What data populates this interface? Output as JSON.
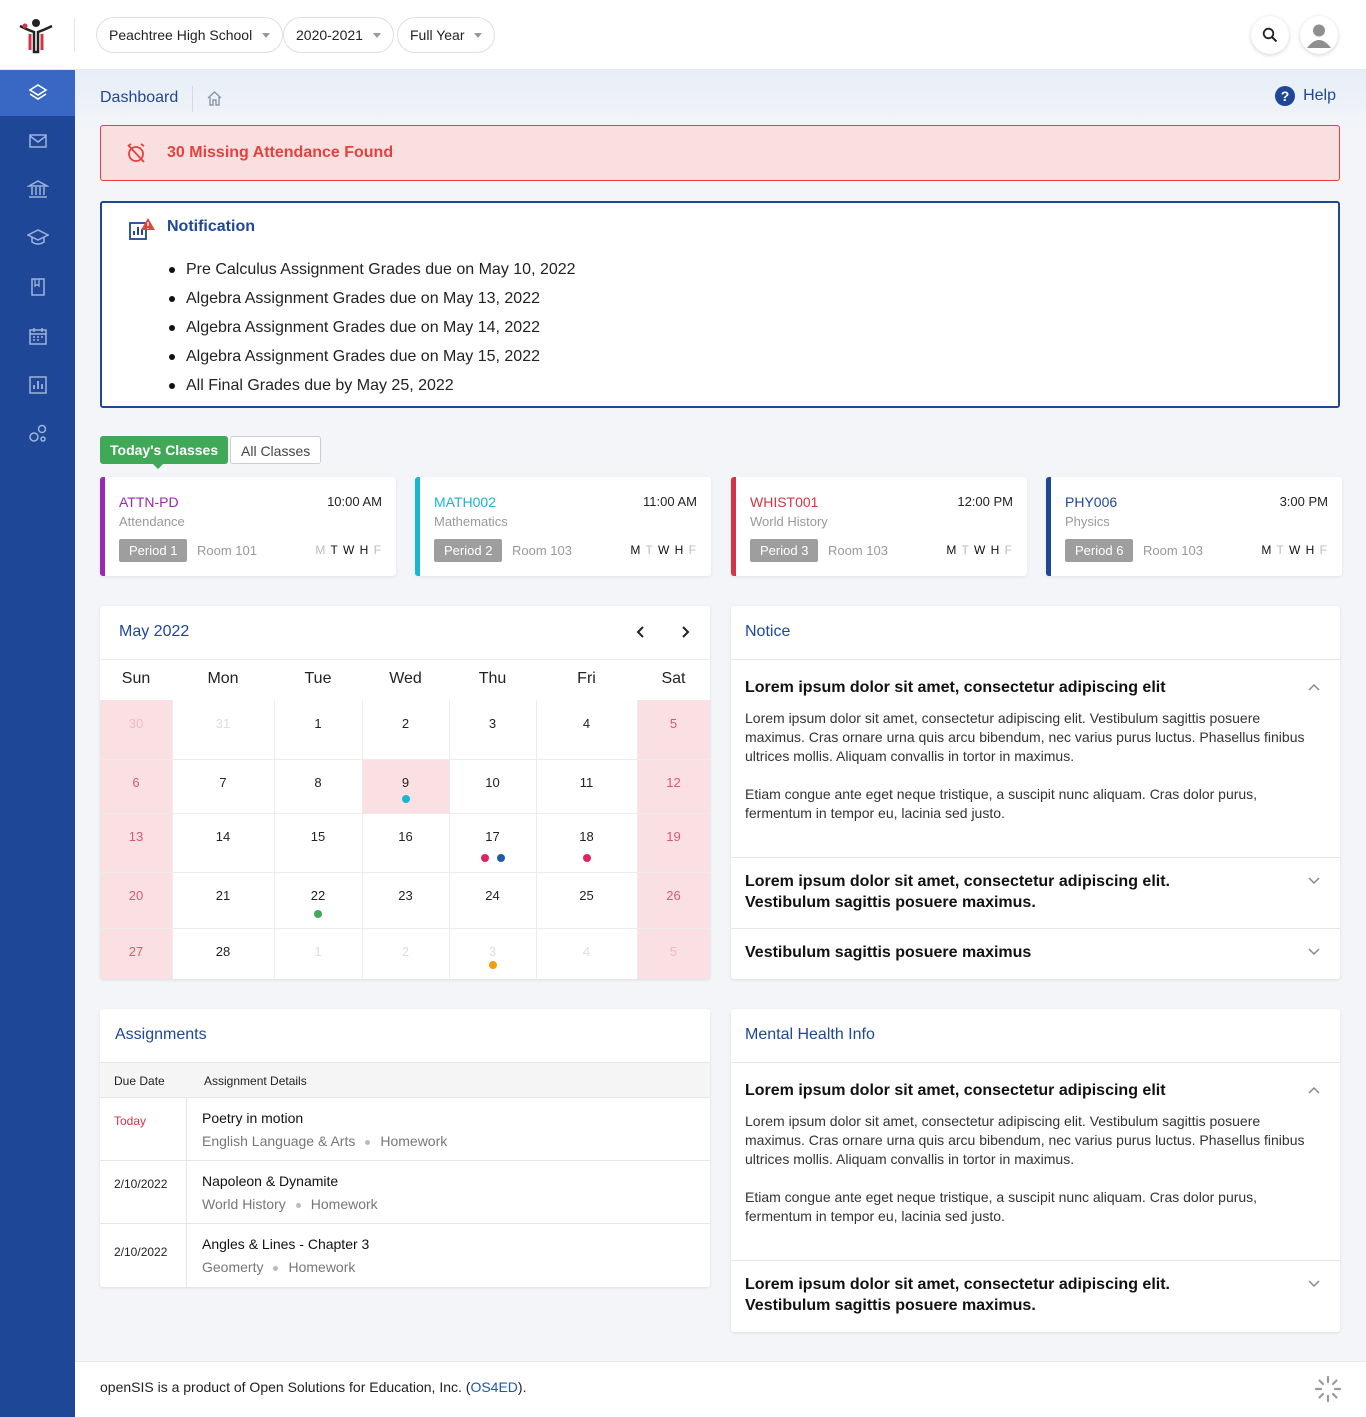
{
  "header": {
    "school": "Peachtree High School",
    "year": "2020-2021",
    "term": "Full Year"
  },
  "breadcrumb": {
    "title": "Dashboard",
    "help": "Help"
  },
  "alert": {
    "text": "30 Missing Attendance Found"
  },
  "notification": {
    "title": "Notification",
    "items": [
      "Pre Calculus Assignment Grades due on May 10, 2022",
      "Algebra Assignment Grades due on May 13, 2022",
      "Algebra Assignment Grades due on May 14, 2022",
      "Algebra Assignment Grades due on May 15, 2022",
      "All Final Grades due by May 25, 2022"
    ]
  },
  "tabs": {
    "today": "Today's Classes",
    "all": "All Classes"
  },
  "classes": [
    {
      "code": "ATTN-PD",
      "time": "10:00 AM",
      "subject": "Attendance",
      "period": "Period 1",
      "room": "Room 101",
      "color": "#9c27b0",
      "days": [
        "M",
        "T",
        "W",
        "H",
        "F"
      ],
      "active": [
        false,
        true,
        true,
        true,
        false
      ]
    },
    {
      "code": "MATH002",
      "time": "11:00 AM",
      "subject": "Mathematics",
      "period": "Period 2",
      "room": "Room 103",
      "color": "#19b6cf",
      "days": [
        "M",
        "T",
        "W",
        "H",
        "F"
      ],
      "active": [
        true,
        false,
        true,
        true,
        false
      ]
    },
    {
      "code": "WHIST001",
      "time": "12:00 PM",
      "subject": "World History",
      "period": "Period 3",
      "room": "Room 103",
      "color": "#d23545",
      "days": [
        "M",
        "T",
        "W",
        "H",
        "F"
      ],
      "active": [
        true,
        false,
        true,
        true,
        false
      ]
    },
    {
      "code": "PHY006",
      "time": "3:00 PM",
      "subject": "Physics",
      "period": "Period 6",
      "room": "Room 103",
      "color": "#1e4797",
      "days": [
        "M",
        "T",
        "W",
        "H",
        "F"
      ],
      "active": [
        true,
        false,
        true,
        true,
        false
      ]
    }
  ],
  "calendar": {
    "month": "May 2022",
    "days_of_week": [
      "Sun",
      "Mon",
      "Tue",
      "Wed",
      "Thu",
      "Fri",
      "Sat"
    ],
    "weeks": [
      [
        "30",
        "31",
        "1",
        "2",
        "3",
        "4",
        "5"
      ],
      [
        "6",
        "7",
        "8",
        "9",
        "10",
        "11",
        "12"
      ],
      [
        "13",
        "14",
        "15",
        "16",
        "17",
        "18",
        "19"
      ],
      [
        "20",
        "21",
        "22",
        "23",
        "24",
        "25",
        "26"
      ],
      [
        "27",
        "28",
        "1",
        "2",
        "3",
        "4",
        "5"
      ]
    ],
    "event_colors": {
      "teal": "#19b6cf",
      "pink": "#e0245e",
      "blue": "#1e5aa8",
      "green": "#3fa957",
      "orange": "#f39c12"
    }
  },
  "notice": {
    "title": "Notice",
    "items": [
      {
        "title": "Lorem ipsum dolor sit amet, consectetur adipiscing elit",
        "body1": "Lorem ipsum dolor sit amet, consectetur adipiscing elit. Vestibulum sagittis posuere maximus. Cras ornare urna quis arcu bibendum, nec varius purus luctus. Phasellus finibus ultrices mollis. Aliquam convallis in tortor in maximus.",
        "body2": "Etiam congue ante eget neque tristique, a suscipit nunc aliquam. Cras dolor purus, fermentum in tempor eu, lacinia sed justo."
      },
      {
        "title_line1": "Lorem ipsum dolor sit amet, consectetur adipiscing elit.",
        "title_line2": "Vestibulum sagittis posuere maximus."
      },
      {
        "title": "Vestibulum sagittis posuere maximus"
      }
    ]
  },
  "assignments": {
    "title": "Assignments",
    "col_due": "Due Date",
    "col_details": "Assignment Details",
    "rows": [
      {
        "due": "Today",
        "title": "Poetry in motion",
        "course": "English Language & Arts",
        "type": "Homework"
      },
      {
        "due": "2/10/2022",
        "title": "Napoleon & Dynamite",
        "course": "World History",
        "type": "Homework"
      },
      {
        "due": "2/10/2022",
        "title": "Angles & Lines - Chapter 3",
        "course": "Geomerty",
        "type": "Homework"
      }
    ]
  },
  "mental_health": {
    "title": "Mental Health Info",
    "items": [
      {
        "title": "Lorem ipsum dolor sit amet, consectetur adipiscing elit",
        "body1": "Lorem ipsum dolor sit amet, consectetur adipiscing elit. Vestibulum sagittis posuere maximus. Cras ornare urna quis arcu bibendum, nec varius purus luctus. Phasellus finibus ultrices mollis. Aliquam convallis in tortor in maximus.",
        "body2": "Etiam congue ante eget neque tristique, a suscipit nunc aliquam. Cras dolor purus, fermentum in tempor eu, lacinia sed justo."
      },
      {
        "title_line1": "Lorem ipsum dolor sit amet, consectetur adipiscing elit.",
        "title_line2": "Vestibulum sagittis posuere maximus."
      }
    ]
  },
  "footer": {
    "text": "openSIS is a product of Open Solutions for Education, Inc. (",
    "link": "OS4ED",
    "end": ")."
  },
  "sidebar_icons": [
    "layers-icon",
    "mail-icon",
    "institution-icon",
    "graduation-cap-icon",
    "book-icon",
    "calendar-icon",
    "reports-icon",
    "settings-gears-icon"
  ]
}
